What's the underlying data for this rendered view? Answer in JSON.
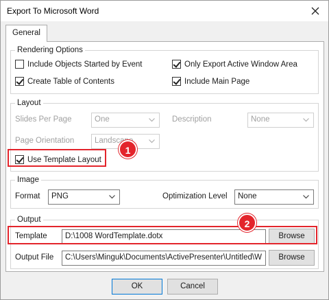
{
  "window": {
    "title": "Export To Microsoft Word"
  },
  "tabs": [
    {
      "label": "General"
    }
  ],
  "rendering": {
    "legend": "Rendering Options",
    "include_objects": {
      "label": "Include Objects Started by Event",
      "checked": false
    },
    "only_export": {
      "label": "Only Export Active Window Area",
      "checked": true
    },
    "create_toc": {
      "label": "Create Table of Contents",
      "checked": true
    },
    "include_main": {
      "label": "Include Main Page",
      "checked": true
    }
  },
  "layout": {
    "legend": "Layout",
    "slides_per_page_label": "Slides Per Page",
    "slides_per_page_value": "One",
    "description_label": "Description",
    "description_value": "None",
    "orientation_label": "Page Orientation",
    "orientation_value": "Landscape",
    "use_template": {
      "label": "Use Template Layout",
      "checked": true
    }
  },
  "image": {
    "legend": "Image",
    "format_label": "Format",
    "format_value": "PNG",
    "optimization_label": "Optimization Level",
    "optimization_value": "None"
  },
  "output": {
    "legend": "Output",
    "template_label": "Template",
    "template_value": "D:\\1008 WordTemplate.dotx",
    "output_file_label": "Output File",
    "output_file_value": "C:\\Users\\Minguk\\Documents\\ActivePresenter\\Untitled\\W",
    "browse_label": "Browse"
  },
  "footer": {
    "ok_label": "OK",
    "cancel_label": "Cancel"
  },
  "annotations": {
    "badge_1": "1",
    "badge_2": "2"
  },
  "colors": {
    "highlight": "#e3242b",
    "default_button_border": "#0078d7"
  }
}
